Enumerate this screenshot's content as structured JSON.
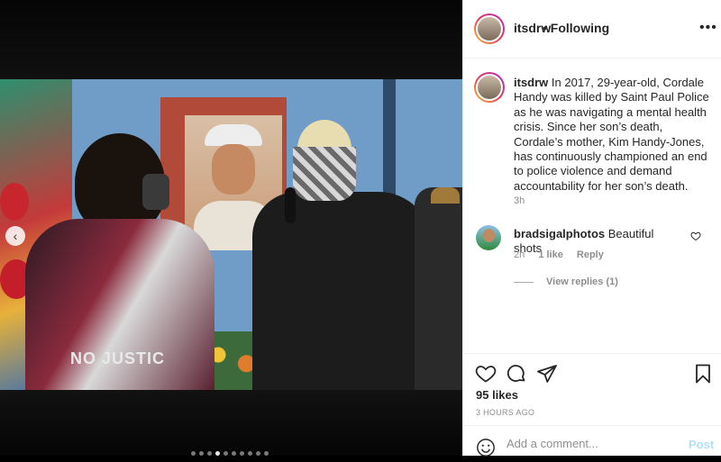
{
  "post": {
    "username": "itsdrw",
    "following_label": "Following",
    "separator": "•",
    "more_label": "•••"
  },
  "caption": {
    "username": "itsdrw",
    "text": "In 2017, 29-year-old, Cordale Handy was killed by Saint Paul Police as he was navigating a mental health crisis. Since her son’s death, Cordale’s mother, Kim Handy-Jones, has continuously championed an end to police violence and demand accountability for her son’s death.",
    "time": "3h"
  },
  "comment": {
    "username": "bradsigalphotos",
    "text": "Beautiful shots",
    "time": "2h",
    "likes": "1 like",
    "reply_label": "Reply",
    "view_replies": "View replies (1)"
  },
  "stats": {
    "likes": "95 likes",
    "posted": "3 HOURS AGO"
  },
  "add_comment": {
    "placeholder": "Add a comment...",
    "post_label": "Post"
  },
  "media": {
    "prev_label": "‹",
    "carousel_count": 10,
    "active_index": 3,
    "jacket_text": "NO JUSTIC"
  },
  "colors": {
    "link_blue": "#b2dffc",
    "text": "#262626",
    "muted": "#8e8e8e"
  }
}
